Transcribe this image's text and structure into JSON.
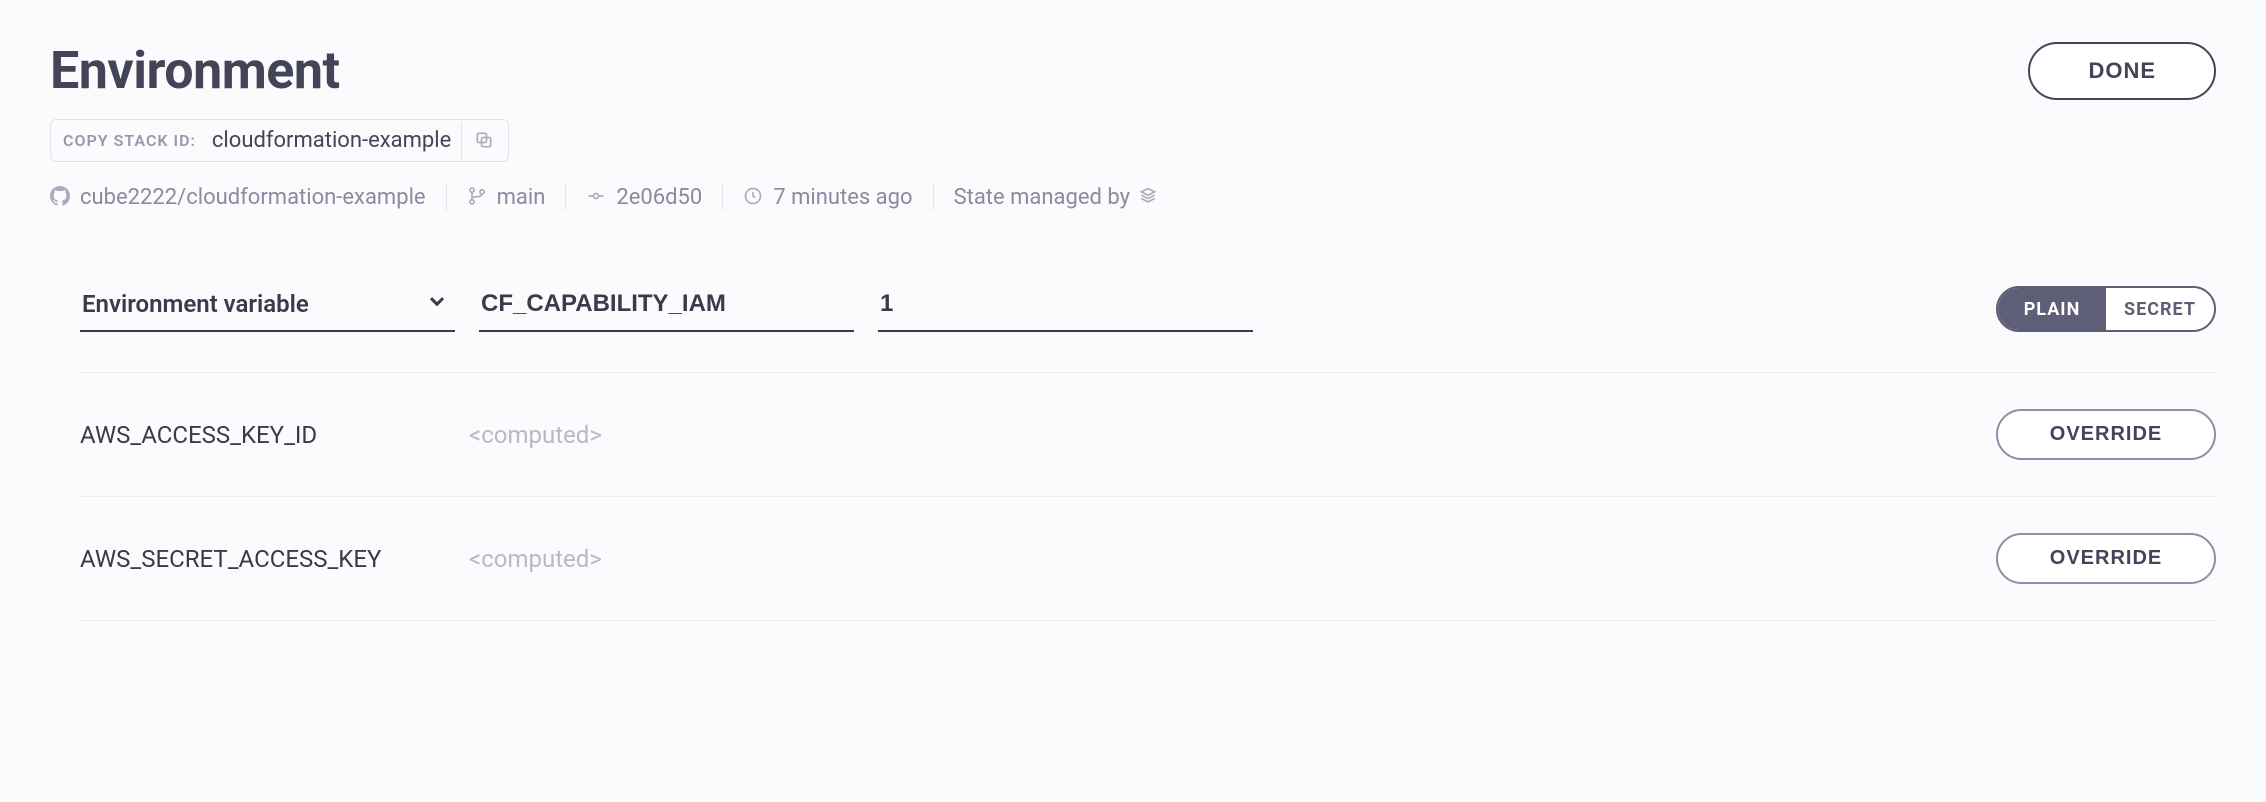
{
  "header": {
    "title": "Environment",
    "done_label": "DONE"
  },
  "stack": {
    "copy_label": "COPY STACK ID:",
    "stack_id": "cloudformation-example"
  },
  "meta": {
    "repo": "cube2222/cloudformation-example",
    "branch": "main",
    "commit": "2e06d50",
    "time": "7 minutes ago",
    "state_label": "State managed by"
  },
  "input": {
    "type_label": "Environment variable",
    "name_value": "CF_CAPABILITY_IAM",
    "value_value": "1",
    "toggle_plain": "PLAIN",
    "toggle_secret": "SECRET"
  },
  "rows": [
    {
      "name": "AWS_ACCESS_KEY_ID",
      "value": "<computed>",
      "btn": "OVERRIDE"
    },
    {
      "name": "AWS_SECRET_ACCESS_KEY",
      "value": "<computed>",
      "btn": "OVERRIDE"
    }
  ]
}
